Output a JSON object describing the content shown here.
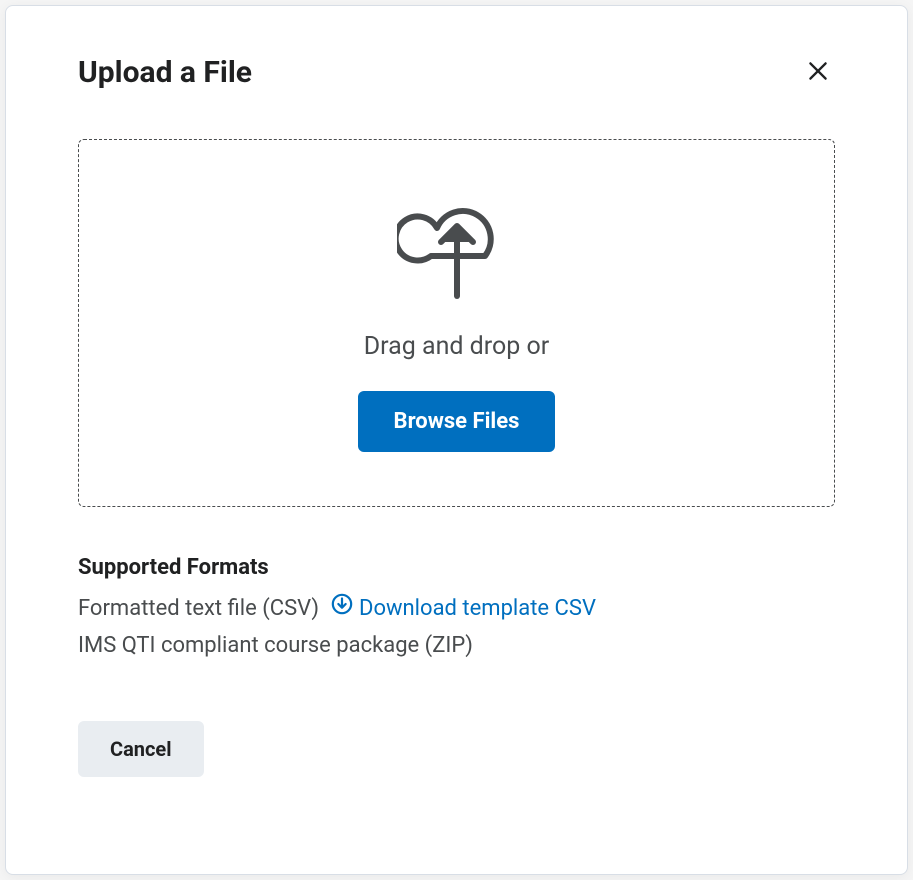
{
  "modal": {
    "title": "Upload a File",
    "dropzone": {
      "prompt": "Drag and drop or",
      "browse_label": "Browse Files"
    },
    "formats": {
      "heading": "Supported Formats",
      "csv_label": "Formatted text file (CSV)",
      "download_template_label": "Download template CSV",
      "zip_label": "IMS QTI compliant course package (ZIP)"
    },
    "cancel_label": "Cancel"
  },
  "colors": {
    "primary": "#006fbf",
    "text": "#202122",
    "muted": "#494c4e",
    "secondary_bg": "#e9edf1"
  }
}
